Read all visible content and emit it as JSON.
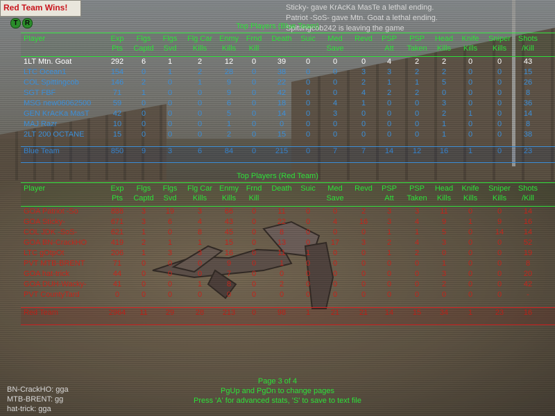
{
  "banner": {
    "text": "Red Team Wins!"
  },
  "team_icons": [
    "T",
    "R"
  ],
  "chat_top": [
    "Sticky- gave KrAcKa MasTe a lethal ending.",
    "Patriot -SoS- gave Mtn. Goat a lethal ending.",
    "Spittingcob242 is leaving the game"
  ],
  "blue": {
    "title": "Top Players (Blue Team)",
    "headers": [
      [
        "Player",
        ""
      ],
      [
        "Exp",
        "Pts"
      ],
      [
        "Flgs",
        "Captd"
      ],
      [
        "Flgs",
        "Svd"
      ],
      [
        "Flg Car",
        "Kills"
      ],
      [
        "Enmy",
        "Kills"
      ],
      [
        "Frnd",
        "Kill"
      ],
      [
        "Death",
        ""
      ],
      [
        "Suic",
        ""
      ],
      [
        "Med",
        "Save"
      ],
      [
        "Revd",
        ""
      ],
      [
        "PSP",
        "Att"
      ],
      [
        "PSP",
        "Taken"
      ],
      [
        "Head",
        "Kills"
      ],
      [
        "Knife",
        "Kills"
      ],
      [
        "Sniper",
        "Kills"
      ],
      [
        "Shots",
        "/Kill"
      ]
    ],
    "rows": [
      [
        "1LT Mtn. Goat",
        "292",
        "6",
        "1",
        "2",
        "12",
        "0",
        "39",
        "0",
        "0",
        "0",
        "4",
        "2",
        "2",
        "0",
        "0",
        "43"
      ],
      [
        "LTC Ocean1",
        "154",
        "0",
        "1",
        "2",
        "28",
        "0",
        "38",
        "0",
        "0",
        "3",
        "3",
        "2",
        "2",
        "0",
        "0",
        "15"
      ],
      [
        "COL Spittingcob",
        "146",
        "2",
        "0",
        "1",
        "9",
        "0",
        "22",
        "0",
        "0",
        "2",
        "1",
        "1",
        "5",
        "0",
        "0",
        "26"
      ],
      [
        "SGT FBF",
        "71",
        "1",
        "0",
        "0",
        "9",
        "0",
        "42",
        "0",
        "0",
        "4",
        "2",
        "2",
        "0",
        "0",
        "0",
        "8"
      ],
      [
        "MSG new06062500",
        "59",
        "0",
        "0",
        "0",
        "6",
        "0",
        "18",
        "0",
        "4",
        "1",
        "0",
        "0",
        "3",
        "0",
        "0",
        "36"
      ],
      [
        "GEN KrAcKa MasT",
        "42",
        "0",
        "0",
        "0",
        "5",
        "0",
        "14",
        "0",
        "3",
        "0",
        "0",
        "0",
        "2",
        "1",
        "0",
        "14"
      ],
      [
        "MAJ Razr",
        "10",
        "0",
        "0",
        "0",
        "1",
        "0",
        "0",
        "0",
        "0",
        "0",
        "0",
        "0",
        "1",
        "0",
        "0",
        "8"
      ],
      [
        "2LT 200 OCTANE",
        "15",
        "0",
        "0",
        "0",
        "2",
        "0",
        "15",
        "0",
        "0",
        "0",
        "0",
        "0",
        "1",
        "0",
        "0",
        "38"
      ]
    ],
    "total": [
      "Blue Team",
      "850",
      "9",
      "3",
      "6",
      "84",
      "0",
      "215",
      "0",
      "7",
      "7",
      "14",
      "12",
      "16",
      "1",
      "0",
      "23"
    ]
  },
  "red": {
    "title": "Top Players (Red Team)",
    "headers": [
      [
        "Player",
        ""
      ],
      [
        "Exp",
        "Pts"
      ],
      [
        "Flgs",
        "Captd"
      ],
      [
        "Flgs",
        "Svd"
      ],
      [
        "Flg Car",
        "Kills"
      ],
      [
        "Enmy",
        "Kills"
      ],
      [
        "Frnd",
        "Kill"
      ],
      [
        "Death",
        ""
      ],
      [
        "Suic",
        ""
      ],
      [
        "Med",
        "Save"
      ],
      [
        "Revd",
        ""
      ],
      [
        "PSP",
        "Att"
      ],
      [
        "PSP",
        "Taken"
      ],
      [
        "Head",
        "Kills"
      ],
      [
        "Knife",
        "Kills"
      ],
      [
        "Sniper",
        "Kills"
      ],
      [
        "Shots",
        "/Kill"
      ]
    ],
    "rows": [
      [
        "GOA Patriot -So",
        "888",
        "3",
        "19",
        "3",
        "66",
        "0",
        "11",
        "0",
        "0",
        "2",
        "3",
        "3",
        "11",
        "0",
        "0",
        "14"
      ],
      [
        "GOA Sticky-",
        "671",
        "3",
        "6",
        "4",
        "43",
        "0",
        "22",
        "0",
        "4",
        "16",
        "3",
        "4",
        "9",
        "1",
        "9",
        "16"
      ],
      [
        "COL JDK -SoS-",
        "621",
        "1",
        "0",
        "8",
        "45",
        "0",
        "8",
        "0",
        "0",
        "0",
        "1",
        "1",
        "5",
        "0",
        "14",
        "14"
      ],
      [
        "GOA BN-CrackHO",
        "419",
        "2",
        "1",
        "1",
        "15",
        "0",
        "13",
        "0",
        "17",
        "3",
        "2",
        "4",
        "3",
        "0",
        "0",
        "52"
      ],
      [
        "LTC gOtpOt",
        "206",
        "1",
        "3",
        "3",
        "16",
        "0",
        "11",
        "1",
        "0",
        "0",
        "1",
        "2",
        "0",
        "0",
        "0",
        "19"
      ],
      [
        "PVT MTB-BRENT",
        "71",
        "0",
        "0",
        "0",
        "9",
        "0",
        "1",
        "0",
        "0",
        "0",
        "0",
        "0",
        "1",
        "0",
        "0",
        "8"
      ],
      [
        "GOA hat-trick",
        "44",
        "0",
        "0",
        "0",
        "7",
        "0",
        "0",
        "0",
        "0",
        "0",
        "0",
        "0",
        "3",
        "0",
        "0",
        "20"
      ],
      [
        "GOA DUH-Wacky-",
        "41",
        "0",
        "0",
        "1",
        "8",
        "0",
        "2",
        "0",
        "0",
        "0",
        "0",
        "0",
        "2",
        "0",
        "0",
        "42"
      ],
      [
        "PVT CountyTard",
        "0",
        "0",
        "0",
        "0",
        "0",
        "0",
        "0",
        "0",
        "0",
        "0",
        "0",
        "0",
        "0",
        "0",
        "0",
        "-"
      ]
    ],
    "total": [
      "Red Team",
      "2964",
      "11",
      "29",
      "28",
      "213",
      "0",
      "98",
      "1",
      "21",
      "21",
      "14",
      "15",
      "34",
      "1",
      "23",
      "16"
    ]
  },
  "footer": {
    "page": "Page 3 of 4",
    "nav": "PgUp and PgDn to change pages",
    "hint": "Press 'A' for advanced stats, 'S' to save to text file"
  },
  "chat_bottom": [
    "BN-CrackHO: gga",
    "MTB-BRENT: gg",
    "hat-trick: gga"
  ]
}
